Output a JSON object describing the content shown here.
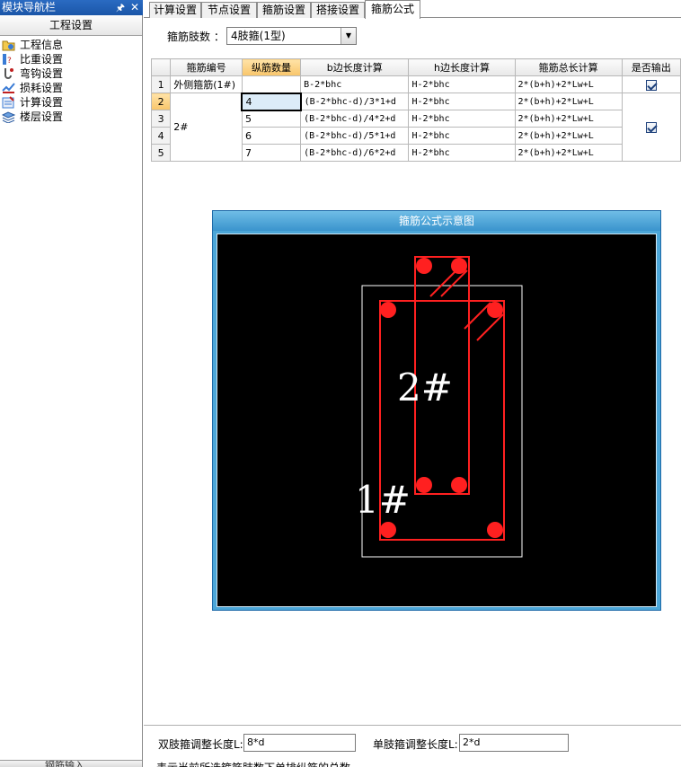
{
  "nav": {
    "title": "模块导航栏",
    "section": "工程设置",
    "items": [
      {
        "label": "工程信息",
        "icon": "folder-info-icon"
      },
      {
        "label": "比重设置",
        "icon": "weight-icon"
      },
      {
        "label": "弯钩设置",
        "icon": "hook-icon"
      },
      {
        "label": "损耗设置",
        "icon": "loss-icon"
      },
      {
        "label": "计算设置",
        "icon": "calc-icon"
      },
      {
        "label": "楼层设置",
        "icon": "floor-icon"
      }
    ],
    "bottom_label": "钢筋输入"
  },
  "tabs": [
    {
      "label": "计算设置",
      "active": false
    },
    {
      "label": "节点设置",
      "active": false
    },
    {
      "label": "箍筋设置",
      "active": false
    },
    {
      "label": "搭接设置",
      "active": false
    },
    {
      "label": "箍筋公式",
      "active": true
    }
  ],
  "legs": {
    "label": "箍筋肢数 ：",
    "value": "4肢箍(1型)"
  },
  "grid": {
    "headers": [
      "",
      "箍筋编号",
      "纵筋数量",
      "b边长度计算",
      "h边长度计算",
      "箍筋总长计算",
      "是否输出"
    ],
    "rows": [
      {
        "n": "1",
        "name": "外侧箍筋(1#)",
        "count": "",
        "b": "B-2*bhc",
        "h": "H-2*bhc",
        "total": "2*(b+h)+2*Lw+L"
      },
      {
        "n": "2",
        "name": "2#",
        "count": "4",
        "b": "(B-2*bhc-d)/3*1+d",
        "h": "H-2*bhc",
        "total": "2*(b+h)+2*Lw+L"
      },
      {
        "n": "3",
        "name": "",
        "count": "5",
        "b": "(B-2*bhc-d)/4*2+d",
        "h": "H-2*bhc",
        "total": "2*(b+h)+2*Lw+L"
      },
      {
        "n": "4",
        "name": "",
        "count": "6",
        "b": "(B-2*bhc-d)/5*1+d",
        "h": "H-2*bhc",
        "total": "2*(b+h)+2*Lw+L"
      },
      {
        "n": "5",
        "name": "",
        "count": "7",
        "b": "(B-2*bhc-d)/6*2+d",
        "h": "H-2*bhc",
        "total": "2*(b+h)+2*Lw+L"
      }
    ]
  },
  "diagram": {
    "title": "箍筋公式示意图",
    "label1": "1#",
    "label2": "2#"
  },
  "adjust": {
    "double_label": "双肢箍调整长度L:",
    "double_value": "8*d",
    "single_label": "单肢箍调整长度L:",
    "single_value": "2*d"
  },
  "hint": "表示当前所选箍筋肢数下单排纵筋的总数"
}
